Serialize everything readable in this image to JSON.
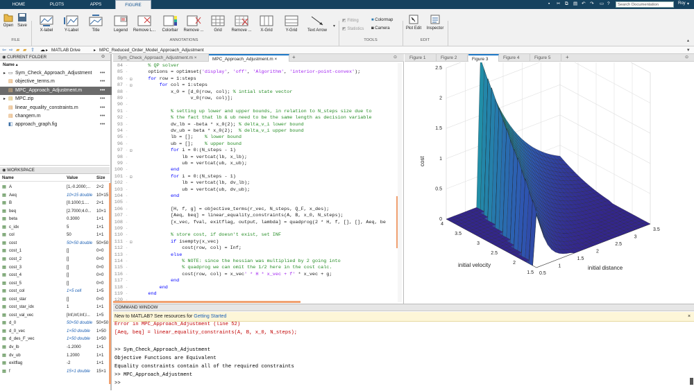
{
  "tabs": {
    "home": "HOME",
    "plots": "PLOTS",
    "apps": "APPS",
    "figure": "FIGURE"
  },
  "search": {
    "placeholder": "Search Documentation"
  },
  "user": "Roy",
  "ribbon": {
    "file": {
      "open": "Open",
      "save": "Save",
      "label": "FILE"
    },
    "annotations": {
      "xlabel": "X-label",
      "ylabel": "Y-Label",
      "title": "Title",
      "legend": "Legend",
      "remove_legend": "Remove L...",
      "colorbar": "Colorbar",
      "remove_colorbar": "Remove ...",
      "grid": "Grid",
      "remove_grid": "Remove ...",
      "xgrid": "X-Grid",
      "ygrid": "Y-Grid",
      "text_arrow": "Text Arrow",
      "label": "ANNOTATIONS"
    },
    "tools": {
      "fitting": "Fitting",
      "statistics": "Statistics",
      "colormap": "Colormap",
      "camera": "Camera",
      "label": "TOOLS"
    },
    "edit": {
      "plot_edit": "Plot Edit",
      "inspector": "Inspector",
      "label": "EDIT"
    }
  },
  "address": {
    "root": "MATLAB Drive",
    "folder": "MPC_Reduced_Order_Model_Approach_Adjustment"
  },
  "current_folder": {
    "title": "CURRENT FOLDER",
    "name_col": "Name",
    "files": [
      "Sym_Check_Approach_Adjustment",
      "objective_terms.m",
      "MPC_Approach_Adjustment.m",
      "MPC.zip",
      "linear_equality_constraints.m",
      "changem.m",
      "approach_graph.fig"
    ]
  },
  "workspace": {
    "title": "WORKSPACE",
    "cols": [
      "Name",
      "Value",
      "Size"
    ],
    "rows": [
      [
        "A",
        "[1,-0.2000;...",
        "2×2"
      ],
      [
        "Aeq",
        "10×15 double",
        "10×15"
      ],
      [
        "B",
        "[0.1000;1....",
        "2×1"
      ],
      [
        "beq",
        "[2.7000;4.0...",
        "10×1"
      ],
      [
        "beta",
        "0.3000",
        "1×1"
      ],
      [
        "c_idx",
        "5",
        "1×1"
      ],
      [
        "col",
        "50",
        "1×1"
      ],
      [
        "cost",
        "50×50 double",
        "50×50"
      ],
      [
        "cost_1",
        "[]",
        "0×0"
      ],
      [
        "cost_2",
        "[]",
        "0×0"
      ],
      [
        "cost_3",
        "[]",
        "0×0"
      ],
      [
        "cost_4",
        "[]",
        "0×0"
      ],
      [
        "cost_5",
        "[]",
        "0×0"
      ],
      [
        "cost_col",
        "1×5 cell",
        "1×5"
      ],
      [
        "cost_star",
        "[]",
        "0×0"
      ],
      [
        "cost_star_idx",
        "1",
        "1×1"
      ],
      [
        "cost_val_vec",
        "[Inf,Inf,Inf,I...",
        "1×5"
      ],
      [
        "d_0",
        "50×50 double",
        "50×50"
      ],
      [
        "d_0_vec",
        "1×50 double",
        "1×50"
      ],
      [
        "d_des_F_vec",
        "1×50 double",
        "1×50"
      ],
      [
        "dv_lb",
        "-1.2000",
        "1×1"
      ],
      [
        "dv_ub",
        "1.2000",
        "1×1"
      ],
      [
        "exitflag",
        "-2",
        "1×1"
      ],
      [
        "f",
        "15×1 double",
        "15×1"
      ]
    ]
  },
  "editor": {
    "tabs": [
      "Sym_Check_Approach_Adjustment.m",
      "MPC_Approach_Adjustment.m"
    ],
    "lines": [
      {
        "n": "84",
        "t": "    % QP solver"
      },
      {
        "n": "85",
        "t": "    options = optimset('display', 'off', 'Algorithm', 'interior-point-convex');"
      },
      {
        "n": "86",
        "t": "    for row = 1:steps"
      },
      {
        "n": "87",
        "t": "        for col = 1:steps"
      },
      {
        "n": "88",
        "t": "            x_0 = [d_0(row, col); % intial state vector"
      },
      {
        "n": "89",
        "t": "                   v_0(row, col)];"
      },
      {
        "n": "90",
        "t": ""
      },
      {
        "n": "91",
        "t": "            % setting up lower and upper bounds, in relation to N_steps size due to"
      },
      {
        "n": "92",
        "t": "            % the fact that lb & ub need to be the same length as decision variable"
      },
      {
        "n": "93",
        "t": "            dv_lb = -beta * x_0(2); % delta_v_i lower bound"
      },
      {
        "n": "94",
        "t": "            dv_ub = beta * x_0(2);  % delta_v_i upper bound"
      },
      {
        "n": "95",
        "t": "            lb = [];    % lower bound"
      },
      {
        "n": "96",
        "t": "            ub = [];    % upper bound"
      },
      {
        "n": "97",
        "t": "            for i = 0:(N_steps - 1)"
      },
      {
        "n": "98",
        "t": "                lb = vertcat(lb, x_lb);"
      },
      {
        "n": "99",
        "t": "                ub = vertcat(ub, x_ub);"
      },
      {
        "n": "100",
        "t": "            end"
      },
      {
        "n": "101",
        "t": "            for i = 0:(N_steps - 1)"
      },
      {
        "n": "102",
        "t": "                lb = vertcat(lb, dv_lb);"
      },
      {
        "n": "103",
        "t": "                ub = vertcat(ub, dv_ub);"
      },
      {
        "n": "104",
        "t": "            end"
      },
      {
        "n": "105",
        "t": ""
      },
      {
        "n": "106",
        "t": "            [H, f, g] = objective_terms(r_vec, N_steps, Q_F, x_des);"
      },
      {
        "n": "107",
        "t": "            [Aeq, beq] = linear_equality_constraints(A, B, x_0, N_steps);"
      },
      {
        "n": "108",
        "t": "            [x_vec, fval, exitflag, output, lambda] = quadprog(2 * H, f, [], [], Aeq, be"
      },
      {
        "n": "109",
        "t": ""
      },
      {
        "n": "110",
        "t": "            % store cost, if doesn't exist, set INF"
      },
      {
        "n": "111",
        "t": "            if isempty(x_vec)"
      },
      {
        "n": "112",
        "t": "                cost(row, col) = Inf;"
      },
      {
        "n": "113",
        "t": "            else"
      },
      {
        "n": "114",
        "t": "                % NOTE: since the hessian was multiplied by 2 going into"
      },
      {
        "n": "115",
        "t": "                % quadprog we can omit the 1/2 here in the cost calc."
      },
      {
        "n": "116",
        "t": "                cost(row, col) = x_vec' * H * x_vec + f' * x_vec + g;"
      },
      {
        "n": "117",
        "t": "            end"
      },
      {
        "n": "118",
        "t": "        end"
      },
      {
        "n": "119",
        "t": "    end"
      },
      {
        "n": "120",
        "t": ""
      }
    ]
  },
  "figures": [
    "Figure 1",
    "Figure 2",
    "Figure 3",
    "Figure 4",
    "Figure 5"
  ],
  "chart_data": {
    "type": "surface",
    "zlabel": "cost",
    "xlabel": "initial distance",
    "ylabel": "initial velocity",
    "x_ticks": [
      "0.5",
      "1",
      "1.5",
      "2",
      "2.5",
      "3",
      "3.5"
    ],
    "y_ticks": [
      "1.5",
      "2",
      "2.5",
      "3",
      "3.5",
      "4"
    ],
    "z_ticks": [
      "0",
      "0.5",
      "1",
      "1.5",
      "2",
      "2.5"
    ]
  },
  "command_window": {
    "title": "COMMAND WINDOW",
    "banner": "New to MATLAB? See resources for ",
    "banner_link": "Getting Started",
    "lines": [
      {
        "t": "Error in MPC_Approach_Adjustment (line 52)",
        "c": "#c00000"
      },
      {
        "t": "[Aeq, beq] = linear_equality_constraints(A, B, x_0, N_steps);",
        "c": "#c00000"
      },
      {
        "t": "",
        "c": "#000"
      },
      {
        "t": ">> Sym_Check_Approach_Adjustment",
        "c": "#000"
      },
      {
        "t": "Objective Functions are Equivalent",
        "c": "#000"
      },
      {
        "t": "Equality constraints contain all of the required constraints",
        "c": "#000"
      },
      {
        "t": ">> MPC_Approach_Adjustment",
        "c": "#000"
      },
      {
        "t": ">>",
        "c": "#000"
      }
    ]
  },
  "colors": {
    "titlebar": "#16425f",
    "ribbon": "#f1f1f1",
    "active_tab": "#1e78c8",
    "keyword": "#0000ff",
    "comment": "#228b22",
    "string": "#a020f0"
  }
}
